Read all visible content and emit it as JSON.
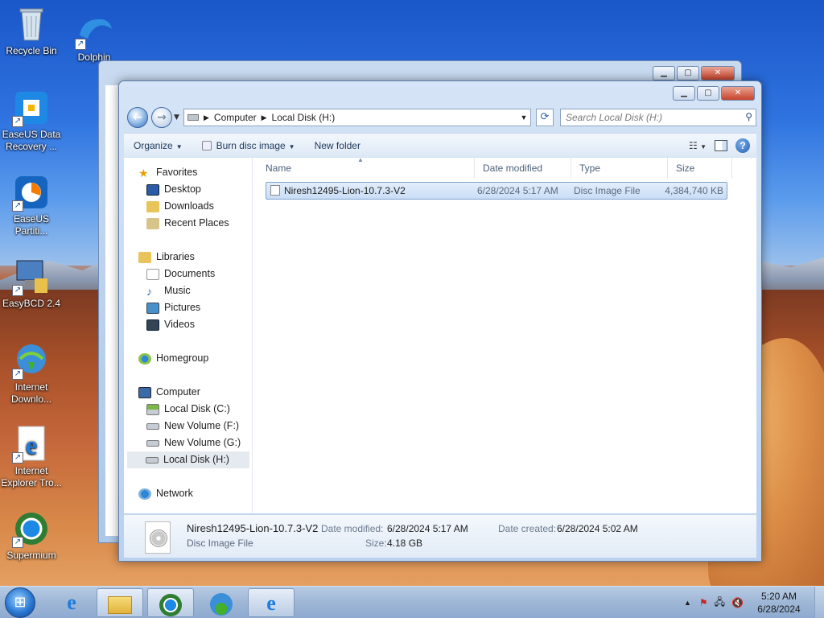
{
  "desktop": {
    "icons": [
      {
        "label": "Recycle Bin",
        "icon": "recycle-bin-icon"
      },
      {
        "label": "Dolphin",
        "icon": "dolphin-icon"
      },
      {
        "label": "EaseUS Data Recovery ...",
        "icon": "easeus-data-recovery-icon"
      },
      {
        "label": "EaseUS Partiti...",
        "icon": "easeus-partition-icon"
      },
      {
        "label": "EasyBCD 2.4",
        "icon": "easybcd-icon"
      },
      {
        "label": "Internet Downlo...",
        "icon": "internet-download-manager-icon"
      },
      {
        "label": "Internet Explorer Tro...",
        "icon": "internet-explorer-icon"
      },
      {
        "label": "Supermium",
        "icon": "supermium-icon"
      }
    ]
  },
  "window": {
    "breadcrumb": [
      "Computer",
      "Local Disk (H:)"
    ],
    "search_placeholder": "Search Local Disk (H:)",
    "toolbar": {
      "organize": "Organize",
      "burn": "Burn disc image",
      "new_folder": "New folder"
    },
    "nav": {
      "favorites": "Favorites",
      "desktop": "Desktop",
      "downloads": "Downloads",
      "recent": "Recent Places",
      "libraries": "Libraries",
      "documents": "Documents",
      "music": "Music",
      "pictures": "Pictures",
      "videos": "Videos",
      "homegroup": "Homegroup",
      "computer": "Computer",
      "disk_c": "Local Disk (C:)",
      "vol_f": "New Volume (F:)",
      "vol_g": "New Volume (G:)",
      "disk_h": "Local Disk (H:)",
      "network": "Network"
    },
    "columns": [
      "Name",
      "Date modified",
      "Type",
      "Size"
    ],
    "files": [
      {
        "name": "Niresh12495-Lion-10.7.3-V2",
        "date": "6/28/2024 5:17 AM",
        "type": "Disc Image File",
        "size": "4,384,740 KB"
      }
    ],
    "details": {
      "name": "Niresh12495-Lion-10.7.3-V2",
      "type": "Disc Image File",
      "date_modified_label": "Date modified:",
      "date_modified": "6/28/2024 5:17 AM",
      "size_label": "Size:",
      "size": "4.18 GB",
      "date_created_label": "Date created:",
      "date_created": "6/28/2024 5:02 AM"
    }
  },
  "taskbar": {
    "time": "5:20 AM",
    "date": "6/28/2024"
  }
}
